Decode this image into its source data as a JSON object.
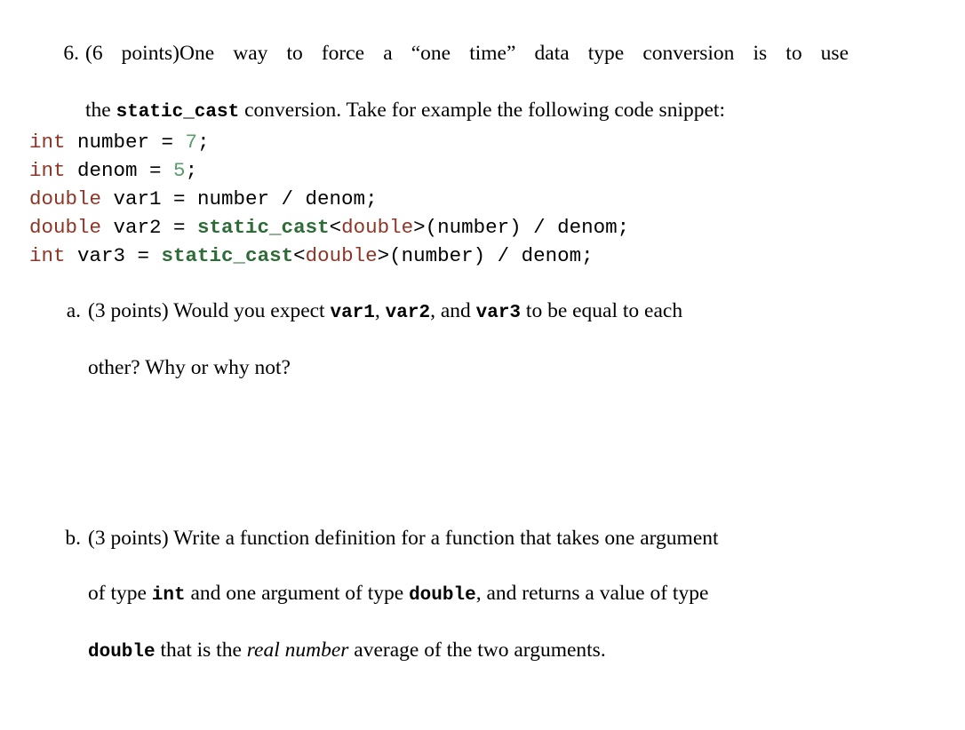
{
  "document": {
    "background_color": "#ffffff",
    "text_color": "#000000"
  },
  "problem": {
    "marker": "6.",
    "points_label": "(6 points)",
    "line1_a": "One way to force a ",
    "line1_quoted": "“one time”",
    "line1_b": " data type conversion is to use",
    "line2_a": "the ",
    "line2_code": "static_cast",
    "line2_b": " conversion.  Take for example the following code snippet:"
  },
  "code": {
    "colors": {
      "keyword": "#8b3626",
      "number_literal": "#5a9c6e",
      "cast_keyword": "#2f6b38",
      "type_in_cast": "#8b3626",
      "plain": "#000000"
    },
    "lines": [
      {
        "tokens": [
          {
            "t": "int",
            "c": "kw"
          },
          {
            "t": " number = ",
            "c": "plain"
          },
          {
            "t": "7",
            "c": "num"
          },
          {
            "t": ";",
            "c": "plain"
          }
        ]
      },
      {
        "tokens": [
          {
            "t": "int",
            "c": "kw"
          },
          {
            "t": " denom = ",
            "c": "plain"
          },
          {
            "t": "5",
            "c": "num"
          },
          {
            "t": ";",
            "c": "plain"
          }
        ]
      },
      {
        "tokens": [
          {
            "t": "double",
            "c": "kw"
          },
          {
            "t": " var1 = number / denom;",
            "c": "plain"
          }
        ]
      },
      {
        "tokens": [
          {
            "t": "double",
            "c": "kw"
          },
          {
            "t": " var2 = ",
            "c": "plain"
          },
          {
            "t": "static_cast",
            "c": "cast"
          },
          {
            "t": "<",
            "c": "plain"
          },
          {
            "t": "double",
            "c": "typ"
          },
          {
            "t": ">(number) / denom;",
            "c": "plain"
          }
        ]
      },
      {
        "tokens": [
          {
            "t": "int",
            "c": "kw"
          },
          {
            "t": " var3 = ",
            "c": "plain"
          },
          {
            "t": "static_cast",
            "c": "cast"
          },
          {
            "t": "<",
            "c": "plain"
          },
          {
            "t": "double",
            "c": "typ"
          },
          {
            "t": ">(number) / denom;",
            "c": "plain"
          }
        ]
      }
    ]
  },
  "subparts": [
    {
      "marker": "a.",
      "points_label": "(3 points)",
      "line1_a": " Would you expect ",
      "var1": "var1",
      "sep1": ", ",
      "var2": "var2",
      "sep2": ", and ",
      "var3": "var3",
      "line1_b": " to be equal to each",
      "line2": "other?  Why or why not?"
    },
    {
      "marker": "b.",
      "points_label": "(3 points)",
      "line1": " Write a function definition for a function that takes one argument",
      "line2_a": "of type ",
      "line2_code1": "int",
      "line2_b": " and one argument of type ",
      "line2_code2": "double",
      "line2_c": ", and returns a value of type",
      "line3_code": "double",
      "line3_a": " that is the ",
      "line3_italic": "real number",
      "line3_b": " average of the two arguments."
    }
  ]
}
